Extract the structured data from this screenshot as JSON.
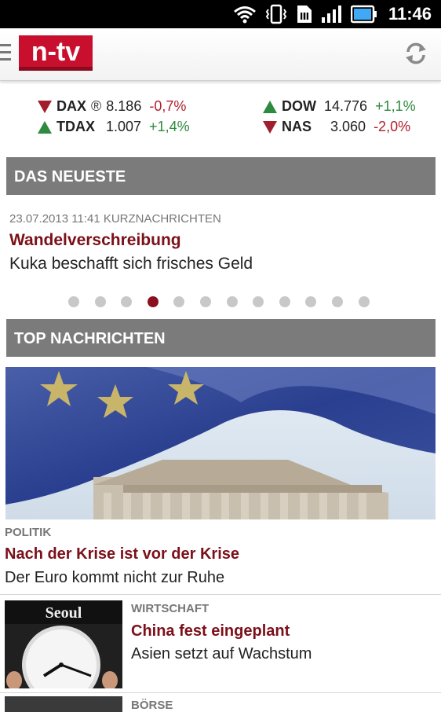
{
  "status_bar": {
    "time": "11:46",
    "icons": [
      "wifi-icon",
      "vibrate-icon",
      "sim-icon",
      "signal-icon",
      "battery-icon"
    ]
  },
  "app_bar": {
    "logo_text": "n-tv",
    "icons": [
      "menu-icon",
      "refresh-icon"
    ]
  },
  "ticker": [
    {
      "name": "DAX",
      "extra": "®",
      "value": "8.186",
      "change": "-0,7%",
      "direction": "down"
    },
    {
      "name": "TDAX",
      "extra": "",
      "value": "1.007",
      "change": "+1,4%",
      "direction": "up"
    },
    {
      "name": "DOW",
      "extra": "",
      "value": "14.776",
      "change": "+1,1%",
      "direction": "up"
    },
    {
      "name": "NAS",
      "extra": "",
      "value": "3.060",
      "change": "-2,0%",
      "direction": "down"
    }
  ],
  "newest": {
    "header": "DAS NEUESTE",
    "meta": "23.07.2013 11:41 KURZNACHRICHTEN",
    "kicker": "Wandelverschreibung",
    "title": "Kuka beschafft sich frisches Geld",
    "pager": {
      "count": 12,
      "active_index": 3
    }
  },
  "top": {
    "header": "TOP NACHRICHTEN",
    "hero": {
      "category": "POLITIK",
      "kicker": "Nach der Krise ist vor der Krise",
      "title": "Der Euro kommt nicht zur Ruhe"
    },
    "items": [
      {
        "category": "WIRTSCHAFT",
        "kicker": "China fest eingeplant",
        "title": "Asien setzt auf Wachstum",
        "image_text": "Seoul"
      },
      {
        "category": "BÖRSE"
      }
    ]
  },
  "colors": {
    "accent": "#7b1019",
    "header_bg": "#7b7b7b",
    "up": "#2e8a3e",
    "down": "#a01e2e"
  }
}
